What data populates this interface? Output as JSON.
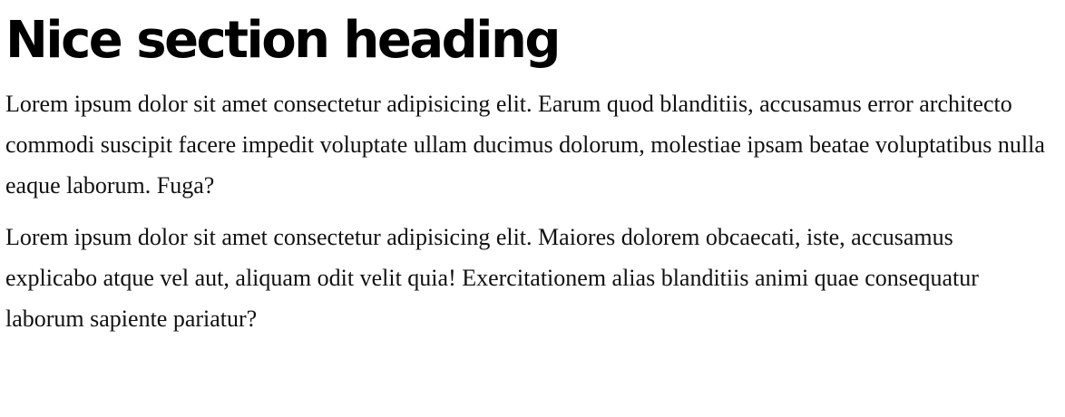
{
  "section": {
    "heading": "Nice section heading",
    "paragraphs": [
      "Lorem ipsum dolor sit amet consectetur adipisicing elit. Earum quod blanditiis, accusamus error architecto commodi suscipit facere impedit voluptate ullam ducimus dolorum, molestiae ipsam beatae voluptatibus nulla eaque laborum. Fuga?",
      "Lorem ipsum dolor sit amet consectetur adipisicing elit. Maiores dolorem obcaecati, iste, accusamus explicabo atque vel aut, aliquam odit velit quia! Exercitationem alias blanditiis animi quae consequatur laborum sapiente pariatur?"
    ]
  }
}
